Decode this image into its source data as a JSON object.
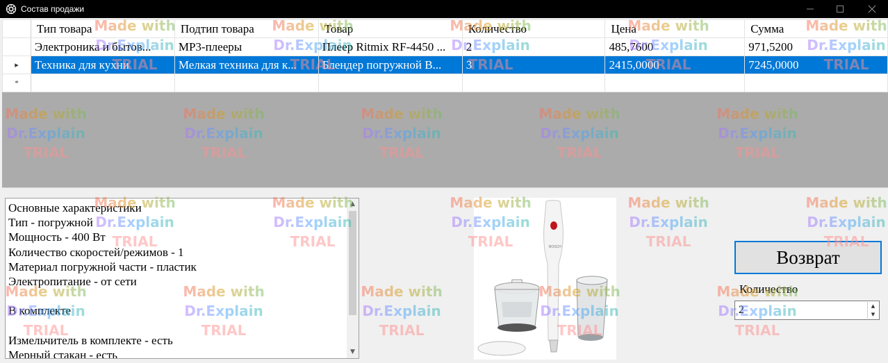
{
  "window": {
    "title": "Состав продажи",
    "app_icon": "gear-emblem-icon",
    "controls": [
      "minimize-icon",
      "maximize-icon",
      "close-icon"
    ]
  },
  "grid": {
    "columns": [
      "Тип товара",
      "Подтип товара",
      "Товар",
      "Количество",
      "Цена",
      "Сумма"
    ],
    "rows": [
      {
        "marker": "",
        "cells": [
          "Электроника и бытов...",
          "MP3-плееры",
          "Плеер Ritmix RF-4450 ...",
          "2",
          "485,7600",
          "971,5200"
        ],
        "selected": false
      },
      {
        "marker": "▸",
        "cells": [
          "Техника для кухни",
          "Мелкая техника для к...",
          "Блендер погружной B...",
          "3",
          "2415,0000",
          "7245,0000"
        ],
        "selected": true
      },
      {
        "marker": "*",
        "cells": [
          "",
          "",
          "",
          "",
          "",
          ""
        ],
        "selected": false
      }
    ]
  },
  "description": {
    "lines": [
      "Основные характеристики",
      "Тип - погружной",
      "Мощность - 400 Вт",
      "Количество скоростей/режимов - 1",
      "Материал погружной части - пластик",
      "Электропитание - от сети",
      "",
      "В комплекте",
      "",
      "Измельчитель в комплекте - есть",
      "Мерный стакан - есть"
    ]
  },
  "product_image": {
    "brand_text": "BOSCH"
  },
  "actions": {
    "return_label": "Возврат",
    "quantity_label": "Количество",
    "quantity_value": "2"
  },
  "watermark": {
    "line1": "Made with",
    "line2": "Dr.Explain",
    "line3": "TRIAL"
  }
}
